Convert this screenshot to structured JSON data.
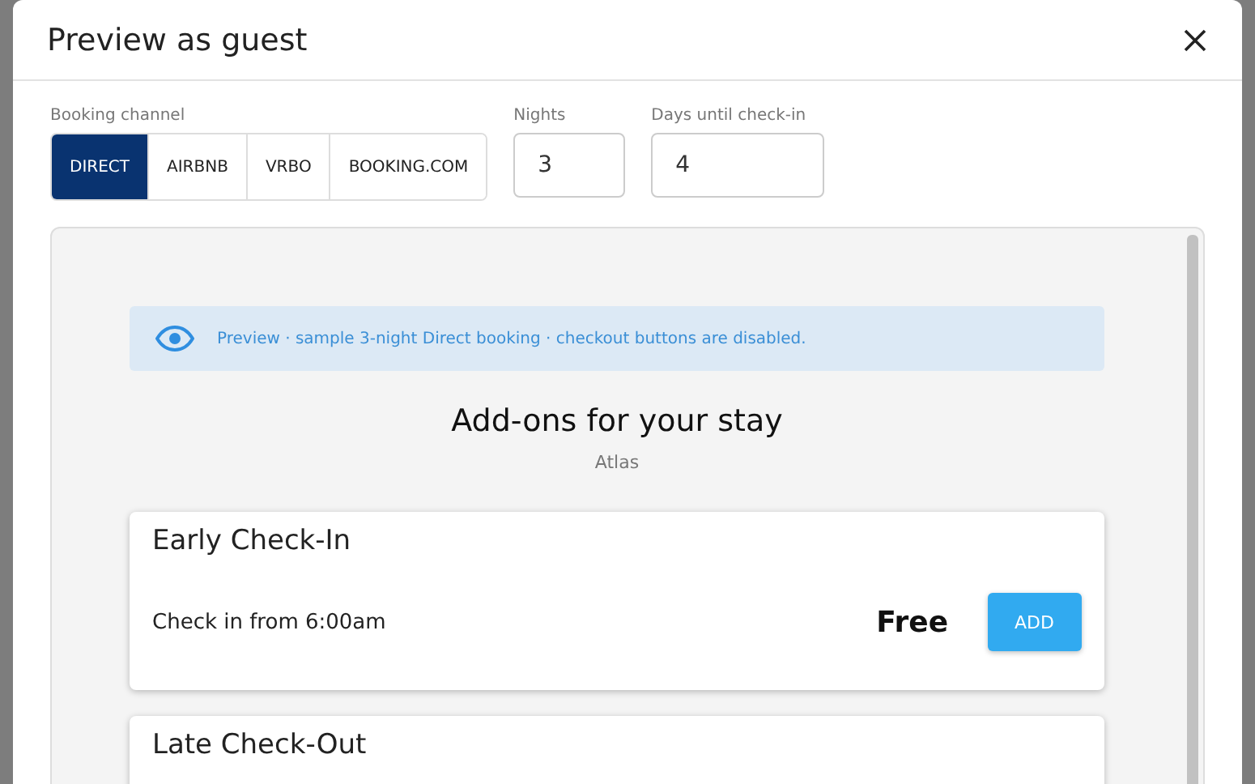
{
  "dialog": {
    "title": "Preview as guest"
  },
  "booking_channel": {
    "label": "Booking channel",
    "options": [
      {
        "label": "DIRECT",
        "selected": true
      },
      {
        "label": "AIRBNB",
        "selected": false
      },
      {
        "label": "VRBO",
        "selected": false
      },
      {
        "label": "BOOKING.COM",
        "selected": false
      }
    ]
  },
  "nights": {
    "label": "Nights",
    "value": "3"
  },
  "days_until_checkin": {
    "label": "Days until check-in",
    "value": "4"
  },
  "preview": {
    "banner": "Preview · sample 3-night Direct booking · checkout buttons are disabled.",
    "heading": "Add-ons for your stay",
    "property": "Atlas",
    "addons": [
      {
        "title": "Early Check-In",
        "description": "Check in from 6:00am",
        "price": "Free",
        "button": "ADD"
      },
      {
        "title": "Late Check-Out"
      }
    ]
  }
}
